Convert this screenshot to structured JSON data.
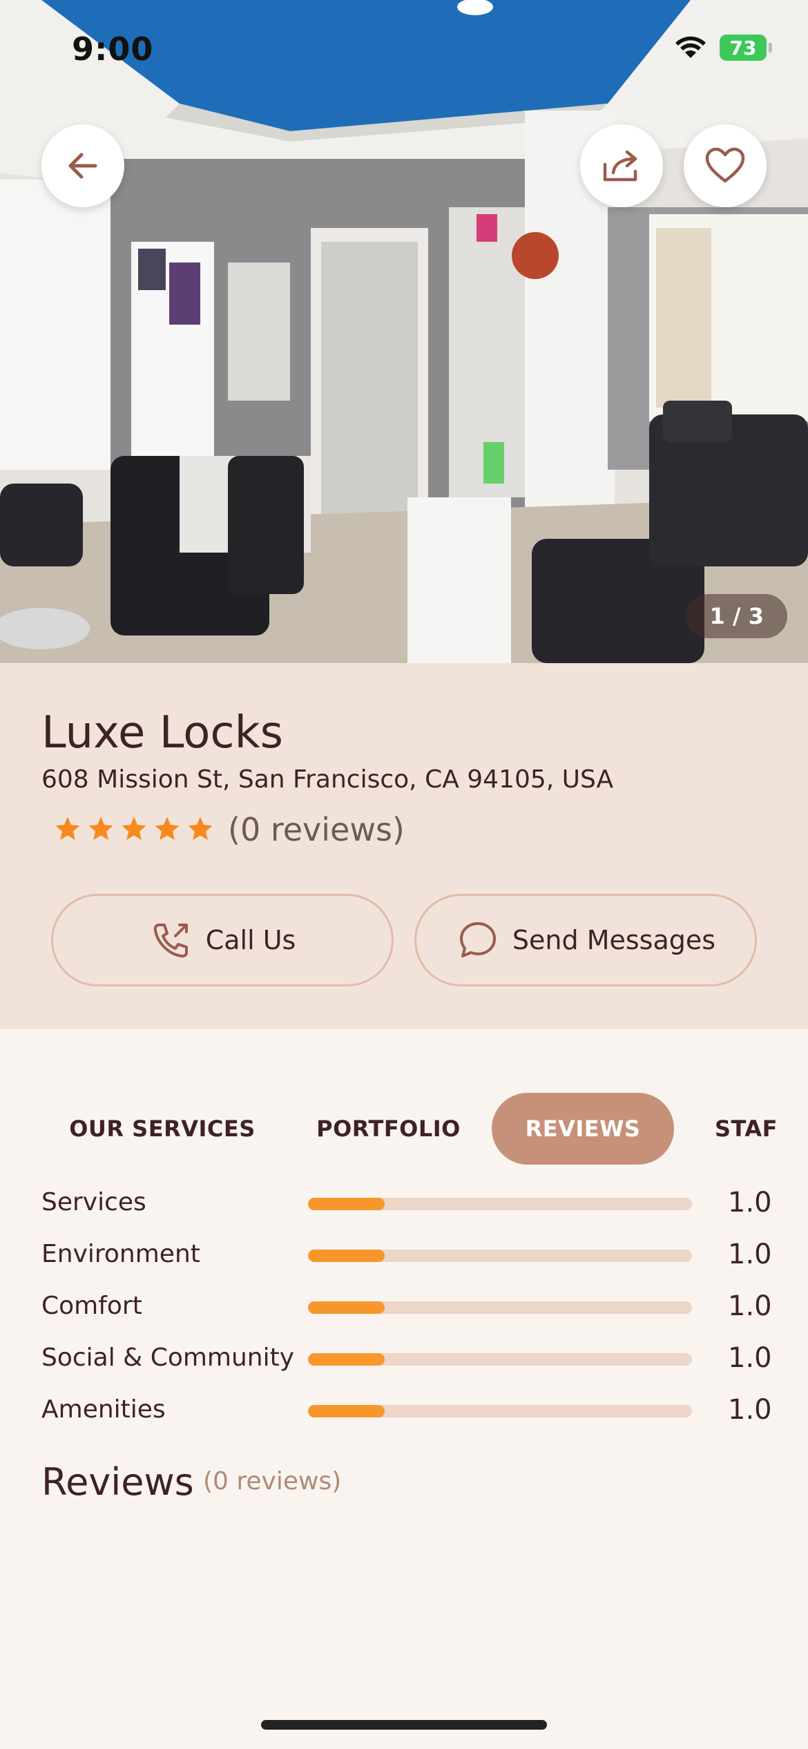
{
  "status_bar": {
    "time": "9:00",
    "battery": "73"
  },
  "gallery": {
    "counter": "1 / 3"
  },
  "header_buttons": {
    "back": "arrow-left-icon",
    "share": "share-icon",
    "favorite": "heart-icon"
  },
  "salon": {
    "name": "Luxe Locks",
    "address": "608 Mission St, San Francisco, CA 94105, USA",
    "rating_stars": 5,
    "reviews_count_label": "(0 reviews)"
  },
  "actions": {
    "call_label": "Call Us",
    "message_label": "Send Messages"
  },
  "tabs": [
    {
      "label": "OUR SERVICES",
      "active": false
    },
    {
      "label": "PORTFOLIO",
      "active": false
    },
    {
      "label": "REVIEWS",
      "active": true
    },
    {
      "label": "STAF",
      "active": false
    }
  ],
  "ratings": [
    {
      "label": "Services",
      "value": "1.0",
      "fraction": 0.2
    },
    {
      "label": "Environment",
      "value": "1.0",
      "fraction": 0.2
    },
    {
      "label": "Comfort",
      "value": "1.0",
      "fraction": 0.2
    },
    {
      "label": "Social & Community",
      "value": "1.0",
      "fraction": 0.2
    },
    {
      "label": "Amenities",
      "value": "1.0",
      "fraction": 0.2
    }
  ],
  "reviews_section": {
    "title": "Reviews",
    "subtitle": "(0 reviews)"
  },
  "colors": {
    "accent": "#c69179",
    "star": "#f7891f",
    "bar_fill": "#f7972b",
    "bar_track": "#ebd6c8"
  }
}
